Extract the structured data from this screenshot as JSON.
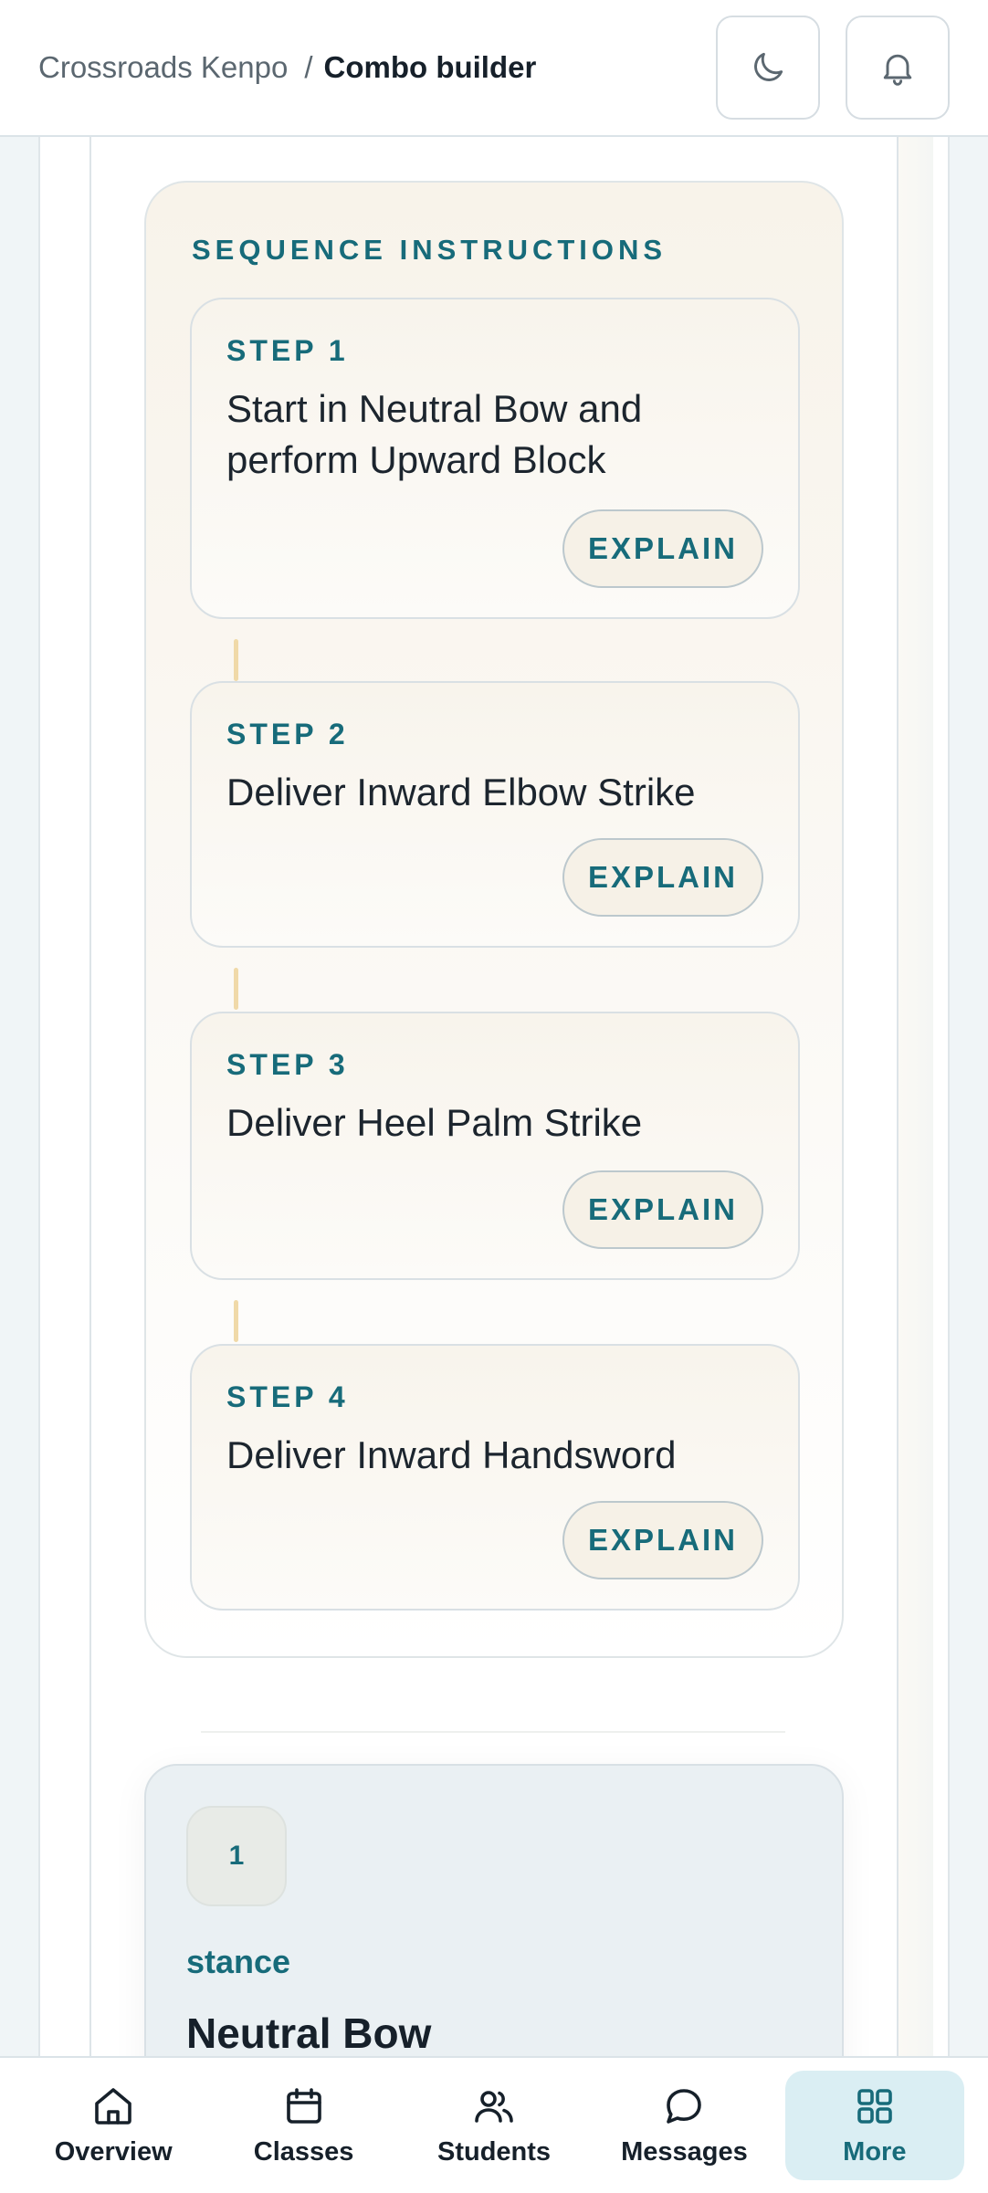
{
  "header": {
    "breadcrumb_parent": "Crossroads Kenpo",
    "breadcrumb_separator": "/",
    "breadcrumb_current": "Combo builder",
    "theme_icon": "moon-icon",
    "notifications_icon": "bell-icon"
  },
  "sequence": {
    "title": "SEQUENCE INSTRUCTIONS",
    "steps": [
      {
        "label": "STEP 1",
        "text": "Start in Neutral Bow and perform Upward Block",
        "button": "EXPLAIN"
      },
      {
        "label": "STEP 2",
        "text": "Deliver Inward Elbow Strike",
        "button": "EXPLAIN"
      },
      {
        "label": "STEP 3",
        "text": "Deliver Heel Palm Strike",
        "button": "EXPLAIN"
      },
      {
        "label": "STEP 4",
        "text": "Deliver Inward Handsword",
        "button": "EXPLAIN"
      }
    ]
  },
  "technique": {
    "index": "1",
    "type": "stance",
    "name": "Neutral Bow"
  },
  "nav": {
    "items": [
      {
        "label": "Overview",
        "icon": "home-icon"
      },
      {
        "label": "Classes",
        "icon": "calendar-icon"
      },
      {
        "label": "Students",
        "icon": "users-icon"
      },
      {
        "label": "Messages",
        "icon": "message-icon"
      },
      {
        "label": "More",
        "icon": "grid-icon",
        "active": true
      }
    ]
  },
  "colors": {
    "accent": "#176b7a",
    "active_nav_bg": "#daeef3"
  }
}
